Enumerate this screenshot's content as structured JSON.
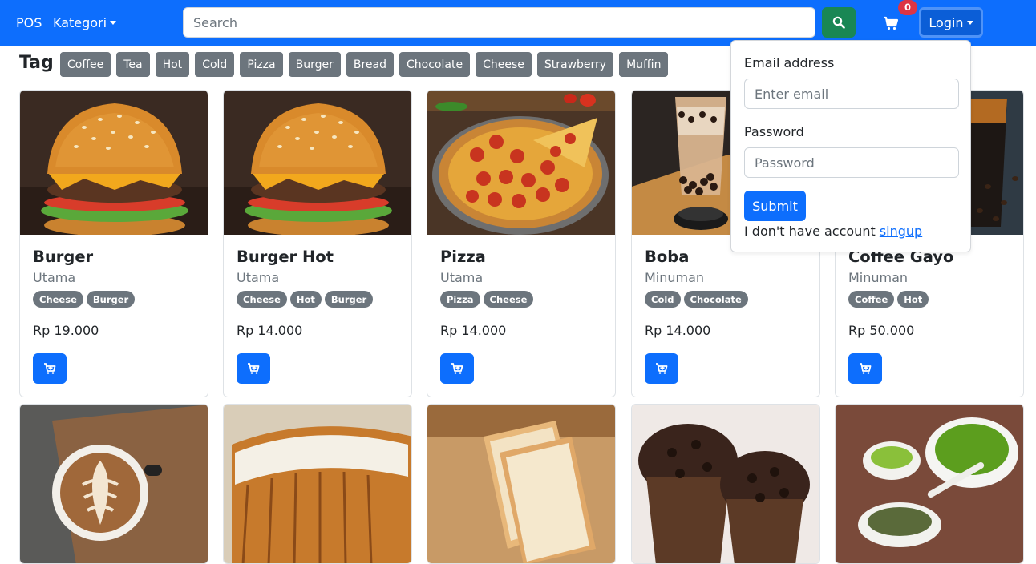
{
  "navbar": {
    "brand": "POS",
    "category_label": "Kategori",
    "search_placeholder": "Search",
    "cart_count": "0",
    "login_label": "Login",
    "colors": {
      "primary": "#0d6efd",
      "success": "#198754",
      "danger": "#dc3545"
    }
  },
  "tags": {
    "title": "Tag :",
    "items": [
      "Coffee",
      "Tea",
      "Hot",
      "Cold",
      "Pizza",
      "Burger",
      "Bread",
      "Chocolate",
      "Cheese",
      "Strawberry",
      "Muffin"
    ]
  },
  "products": [
    {
      "name": "Burger",
      "category": "Utama",
      "tags": [
        "Cheese",
        "Burger"
      ],
      "price": "Rp 19.000",
      "image": "burger"
    },
    {
      "name": "Burger Hot",
      "category": "Utama",
      "tags": [
        "Cheese",
        "Hot",
        "Burger"
      ],
      "price": "Rp 14.000",
      "image": "burger"
    },
    {
      "name": "Pizza",
      "category": "Utama",
      "tags": [
        "Pizza",
        "Cheese"
      ],
      "price": "Rp 14.000",
      "image": "pizza"
    },
    {
      "name": "Boba",
      "category": "Minuman",
      "tags": [
        "Cold",
        "Chocolate"
      ],
      "price": "Rp 14.000",
      "image": "boba"
    },
    {
      "name": "Coffee Gayo",
      "category": "Minuman",
      "tags": [
        "Coffee",
        "Hot"
      ],
      "price": "Rp 50.000",
      "image": "coffee"
    }
  ],
  "products_row2": [
    {
      "image": "latte"
    },
    {
      "image": "cheese-toast"
    },
    {
      "image": "bread"
    },
    {
      "image": "muffin"
    },
    {
      "image": "green-tea"
    }
  ],
  "login_form": {
    "email_label": "Email address",
    "email_placeholder": "Enter email",
    "password_label": "Password",
    "password_placeholder": "Password",
    "submit_label": "Submit",
    "no_account_text": "I don't have account",
    "signup_label": "singup"
  }
}
